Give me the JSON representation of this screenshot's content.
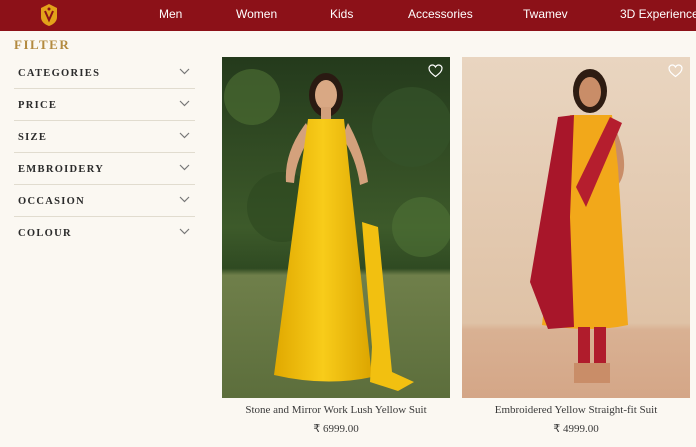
{
  "header": {
    "nav": [
      "Men",
      "Women",
      "Kids",
      "Accessories",
      "Twamev",
      "3D Experience"
    ],
    "brand_color": "#8c1118"
  },
  "filter": {
    "title": "FILTER",
    "items": [
      "CATEGORIES",
      "PRICE",
      "SIZE",
      "EMBROIDERY",
      "OCCASION",
      "COLOUR"
    ]
  },
  "products": [
    {
      "name": "Stone and Mirror Work Lush Yellow Suit",
      "price": "₹ 6999.00",
      "icon": "heart-outline-icon"
    },
    {
      "name": "Embroidered Yellow Straight-fit Suit",
      "price": "₹ 4999.00",
      "icon": "heart-outline-icon"
    }
  ]
}
